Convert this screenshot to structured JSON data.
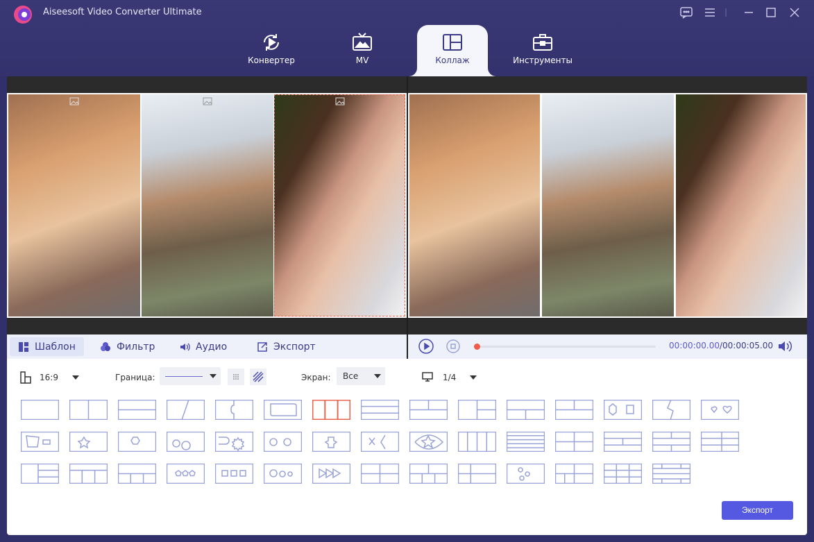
{
  "app": {
    "title": "Aiseesoft Video Converter Ultimate"
  },
  "tabs": [
    {
      "label": "Конвертер",
      "icon": "converter-icon"
    },
    {
      "label": "MV",
      "icon": "tv-icon"
    },
    {
      "label": "Коллаж",
      "icon": "collage-icon",
      "active": true
    },
    {
      "label": "Инструменты",
      "icon": "toolbox-icon"
    }
  ],
  "control_tabs": [
    {
      "label": "Шаблон",
      "icon": "template-icon",
      "active": true
    },
    {
      "label": "Фильтр",
      "icon": "filter-icon"
    },
    {
      "label": "Аудио",
      "icon": "audio-icon"
    },
    {
      "label": "Экспорт",
      "icon": "export-icon"
    }
  ],
  "player": {
    "current_time": "00:00:00.00",
    "separator": "/",
    "total_time": "00:00:05.00",
    "progress": 0
  },
  "options": {
    "aspect_ratio": "16:9",
    "border_label": "Граница:",
    "screen_label": "Экран:",
    "screen_value": "Все",
    "page": "1/4"
  },
  "colors": {
    "accent": "#5558e0",
    "selected_template": "#e8654f",
    "title_bg": "#34326d",
    "template_stroke": "#9aa3d8"
  },
  "export_button": "Экспорт"
}
